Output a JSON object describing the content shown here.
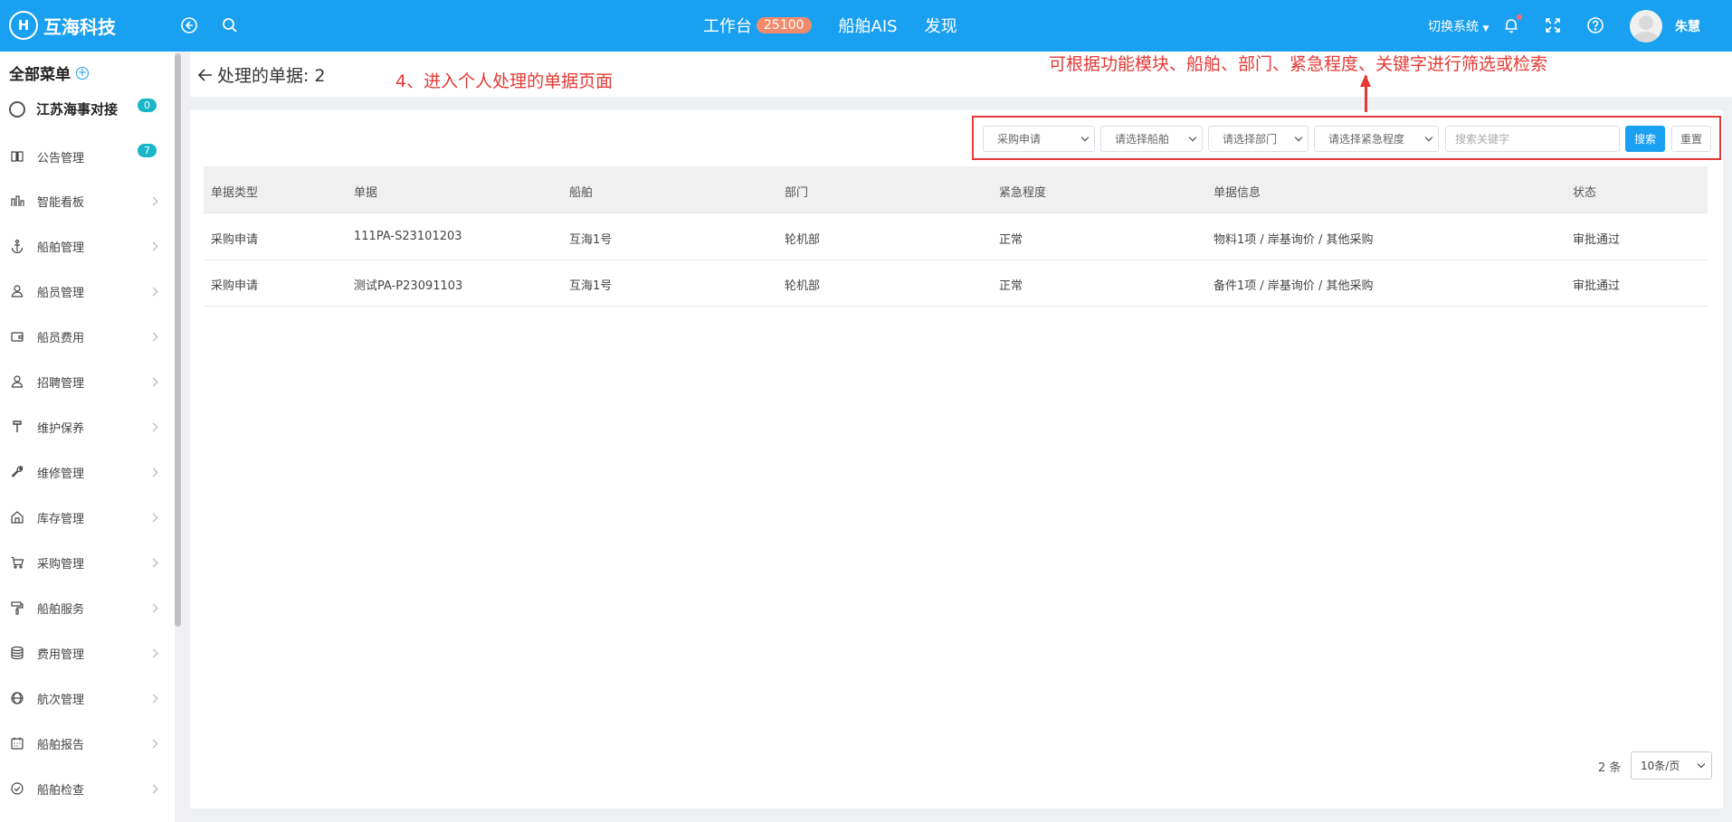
{
  "header": {
    "logo_mark": "H",
    "logo_text": "互海科技",
    "nav": [
      {
        "label": "工作台",
        "badge": "25100"
      },
      {
        "label": "船舶AIS"
      },
      {
        "label": "发现"
      }
    ],
    "switch_system": "切换系统",
    "user_name": "朱慧",
    "icons": [
      "back-circle-icon",
      "search-icon",
      "bell-icon",
      "fullscreen-icon",
      "help-icon"
    ]
  },
  "sidebar": {
    "title": "全部菜单",
    "plus": "+",
    "org": {
      "label": "江苏海事对接",
      "badge": "0"
    },
    "items": [
      {
        "label": "公告管理",
        "icon": "book-icon",
        "badge": "7"
      },
      {
        "label": "智能看板",
        "icon": "bar-chart-icon"
      },
      {
        "label": "船舶管理",
        "icon": "anchor-icon"
      },
      {
        "label": "船员管理",
        "icon": "person-icon"
      },
      {
        "label": "船员费用",
        "icon": "wallet-icon"
      },
      {
        "label": "招聘管理",
        "icon": "recruit-icon"
      },
      {
        "label": "维护保养",
        "icon": "hammer-icon"
      },
      {
        "label": "维修管理",
        "icon": "wrench-icon"
      },
      {
        "label": "库存管理",
        "icon": "warehouse-icon"
      },
      {
        "label": "采购管理",
        "icon": "cart-icon"
      },
      {
        "label": "船舶服务",
        "icon": "roller-icon"
      },
      {
        "label": "费用管理",
        "icon": "database-icon"
      },
      {
        "label": "航次管理",
        "icon": "globe-icon"
      },
      {
        "label": "船舶报告",
        "icon": "calendar-icon"
      },
      {
        "label": "船舶检查",
        "icon": "check-circle-icon"
      }
    ]
  },
  "page": {
    "title": "处理的单据: 2"
  },
  "annotations": {
    "step": "4、进入个人处理的单据页面",
    "filter_hint": "可根据功能模块、船舶、部门、紧急程度、关键字进行筛选或检索"
  },
  "filters": {
    "module": "采购申请",
    "ship": "请选择船舶",
    "department": "请选择部门",
    "urgency": "请选择紧急程度",
    "keyword_placeholder": "搜索关键字",
    "search_button": "搜索",
    "reset_button": "重置"
  },
  "table": {
    "columns": [
      "单据类型",
      "单据",
      "船舶",
      "部门",
      "紧急程度",
      "单据信息",
      "状态"
    ],
    "rows": [
      [
        "采购申请",
        "111PA-S23101203",
        "互海1号",
        "轮机部",
        "正常",
        "物料1项 / 岸基询价 / 其他采购",
        "审批通过"
      ],
      [
        "采购申请",
        "测试PA-P23091103",
        "互海1号",
        "轮机部",
        "正常",
        "备件1项 / 岸基询价 / 其他采购",
        "审批通过"
      ]
    ]
  },
  "pagination": {
    "total": "2 条",
    "page_size": "10条/页"
  }
}
